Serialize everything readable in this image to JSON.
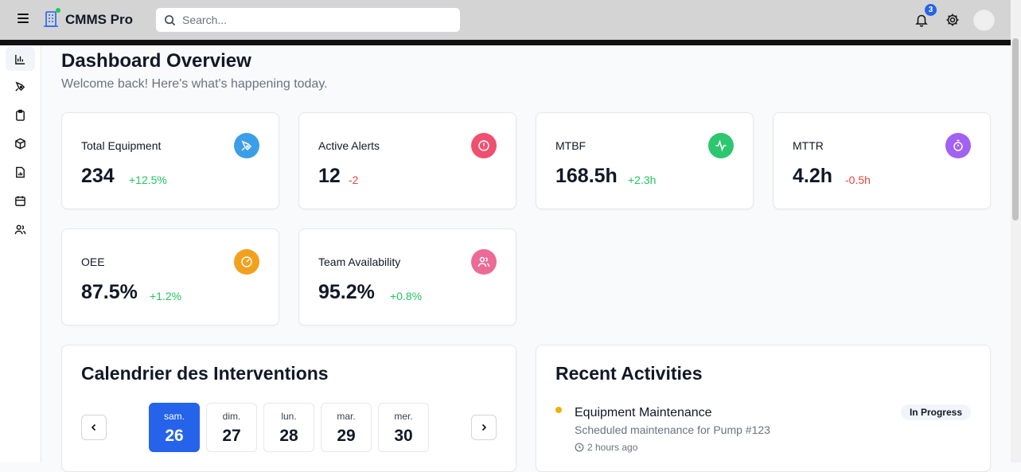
{
  "header": {
    "app_name": "CMMS Pro",
    "search_placeholder": "Search...",
    "notification_count": "3",
    "icons": [
      "menu-icon",
      "building-icon",
      "search-icon",
      "bell-icon",
      "gear-icon",
      "avatar"
    ]
  },
  "sidebar": {
    "items": [
      {
        "icon": "bar-chart-icon",
        "active": true
      },
      {
        "icon": "wrench-icon",
        "active": false
      },
      {
        "icon": "clipboard-icon",
        "active": false
      },
      {
        "icon": "package-icon",
        "active": false
      },
      {
        "icon": "report-file-icon",
        "active": false
      },
      {
        "icon": "calendar-icon",
        "active": false
      },
      {
        "icon": "users-icon",
        "active": false
      }
    ]
  },
  "dashboard": {
    "title": "Dashboard Overview",
    "subtitle": "Welcome back! Here's what's happening today."
  },
  "stats": [
    {
      "label": "Total Equipment",
      "value": "234",
      "change": "+12.5%",
      "trend": "up",
      "icon": "wrench-icon",
      "color": "#3b9ee8"
    },
    {
      "label": "Active Alerts",
      "value": "12",
      "change": "-2",
      "trend": "down",
      "icon": "alert-circle-icon",
      "color": "#f0506e"
    },
    {
      "label": "MTBF",
      "value": "168.5h",
      "change": "+2.3h",
      "trend": "up",
      "icon": "activity-icon",
      "color": "#2cc76f"
    },
    {
      "label": "MTTR",
      "value": "4.2h",
      "change": "-0.5h",
      "trend": "down",
      "icon": "timer-icon",
      "color": "#a261f0"
    },
    {
      "label": "OEE",
      "value": "87.5%",
      "change": "+1.2%",
      "trend": "up",
      "icon": "gauge-icon",
      "color": "#f2a11f"
    },
    {
      "label": "Team Availability",
      "value": "95.2%",
      "change": "+0.8%",
      "trend": "up",
      "icon": "users-icon",
      "color": "#ec6a96"
    }
  ],
  "colors": {
    "up": "#22c55e",
    "down": "#ef4444",
    "accent": "#2563eb"
  },
  "calendar": {
    "title": "Calendrier des Interventions",
    "days": [
      {
        "name": "sam.",
        "num": "26",
        "selected": true
      },
      {
        "name": "dim.",
        "num": "27",
        "selected": false
      },
      {
        "name": "lun.",
        "num": "28",
        "selected": false
      },
      {
        "name": "mar.",
        "num": "29",
        "selected": false
      },
      {
        "name": "mer.",
        "num": "30",
        "selected": false
      }
    ]
  },
  "activities": {
    "title": "Recent Activities",
    "items": [
      {
        "title": "Equipment Maintenance",
        "description": "Scheduled maintenance for Pump #123",
        "time": "2 hours ago",
        "status": "In Progress",
        "dot_color": "#eab308"
      }
    ]
  }
}
